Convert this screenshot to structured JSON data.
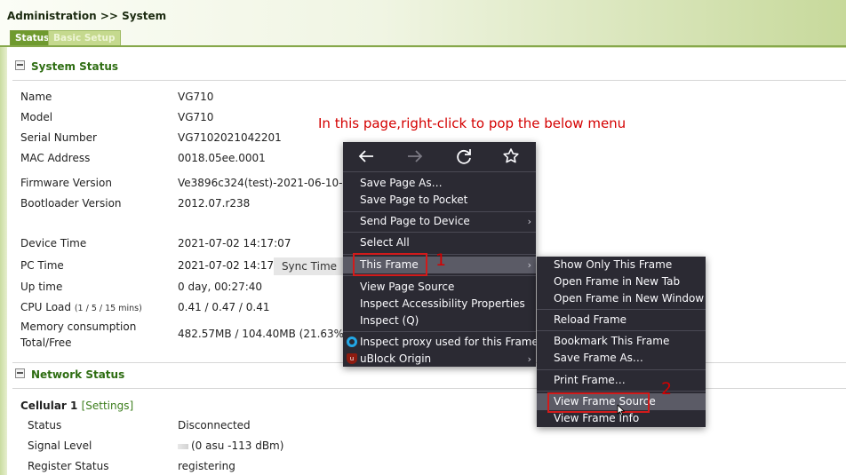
{
  "header": {
    "breadcrumb": "Administration >> System",
    "tabs": [
      {
        "label": "Status"
      },
      {
        "label": "Basic Setup"
      }
    ]
  },
  "system_status": {
    "title": "System Status",
    "rows": [
      {
        "label": "Name",
        "value": "VG710"
      },
      {
        "label": "Model",
        "value": "VG710"
      },
      {
        "label": "Serial Number",
        "value": "VG7102021042201"
      },
      {
        "label": "MAC Address",
        "value": "0018.05ee.0001"
      },
      {
        "label": "Firmware Version",
        "value": "Ve3896c324(test)-2021-06-10-18-49"
      },
      {
        "label": "Bootloader Version",
        "value": "2012.07.r238"
      },
      {
        "label": "Device Time",
        "value": "2021-07-02 14:17:07"
      },
      {
        "label": "PC Time",
        "value": "2021-07-02 14:17:08"
      },
      {
        "label": "Up time",
        "value": "0 day, 00:27:40"
      },
      {
        "label": "CPU Load",
        "label_small": "(1 / 5 / 15 mins)",
        "value": "0.41 / 0.47 / 0.41"
      },
      {
        "label": "Memory consumption",
        "label2": "Total/Free",
        "value": "482.57MB / 104.40MB (21.63%)"
      }
    ],
    "sync_time_label": "Sync Time"
  },
  "network_status": {
    "title": "Network Status",
    "cellular_label": "Cellular 1",
    "settings_link": "[Settings]",
    "rows": [
      {
        "label": "Status",
        "value": "Disconnected"
      },
      {
        "label": "Signal Level",
        "value": "(0 asu -113 dBm)"
      },
      {
        "label": "Register Status",
        "value": "registering"
      }
    ]
  },
  "annotation": {
    "instruction": "In this page,right-click to pop the below menu",
    "step1": "1",
    "step2": "2",
    "color": "#d40000"
  },
  "context_menu": {
    "nav_icons": [
      "back-arrow-icon",
      "forward-arrow-icon",
      "reload-icon",
      "bookmark-star-icon"
    ],
    "items": [
      {
        "label": "Save Page As…"
      },
      {
        "label": "Save Page to Pocket"
      },
      {
        "label": "Send Page to Device"
      },
      {
        "label": "Select All"
      },
      {
        "label": "This Frame"
      },
      {
        "label": "View Page Source"
      },
      {
        "label": "Inspect Accessibility Properties"
      },
      {
        "label": "Inspect (Q)"
      },
      {
        "label": "Inspect proxy used for this Frame"
      },
      {
        "label": "uBlock Origin"
      }
    ]
  },
  "frame_submenu": {
    "items": [
      {
        "label": "Show Only This Frame"
      },
      {
        "label": "Open Frame in New Tab"
      },
      {
        "label": "Open Frame in New Window"
      },
      {
        "label": "Reload Frame"
      },
      {
        "label": "Bookmark This Frame"
      },
      {
        "label": "Save Frame As…"
      },
      {
        "label": "Print Frame…"
      },
      {
        "label": "View Frame Source"
      },
      {
        "label": "View Frame Info"
      }
    ]
  },
  "colors": {
    "section_title": "#2e6d12",
    "menu_background": "#2b2a33",
    "menu_highlight": "#5b5b66"
  }
}
